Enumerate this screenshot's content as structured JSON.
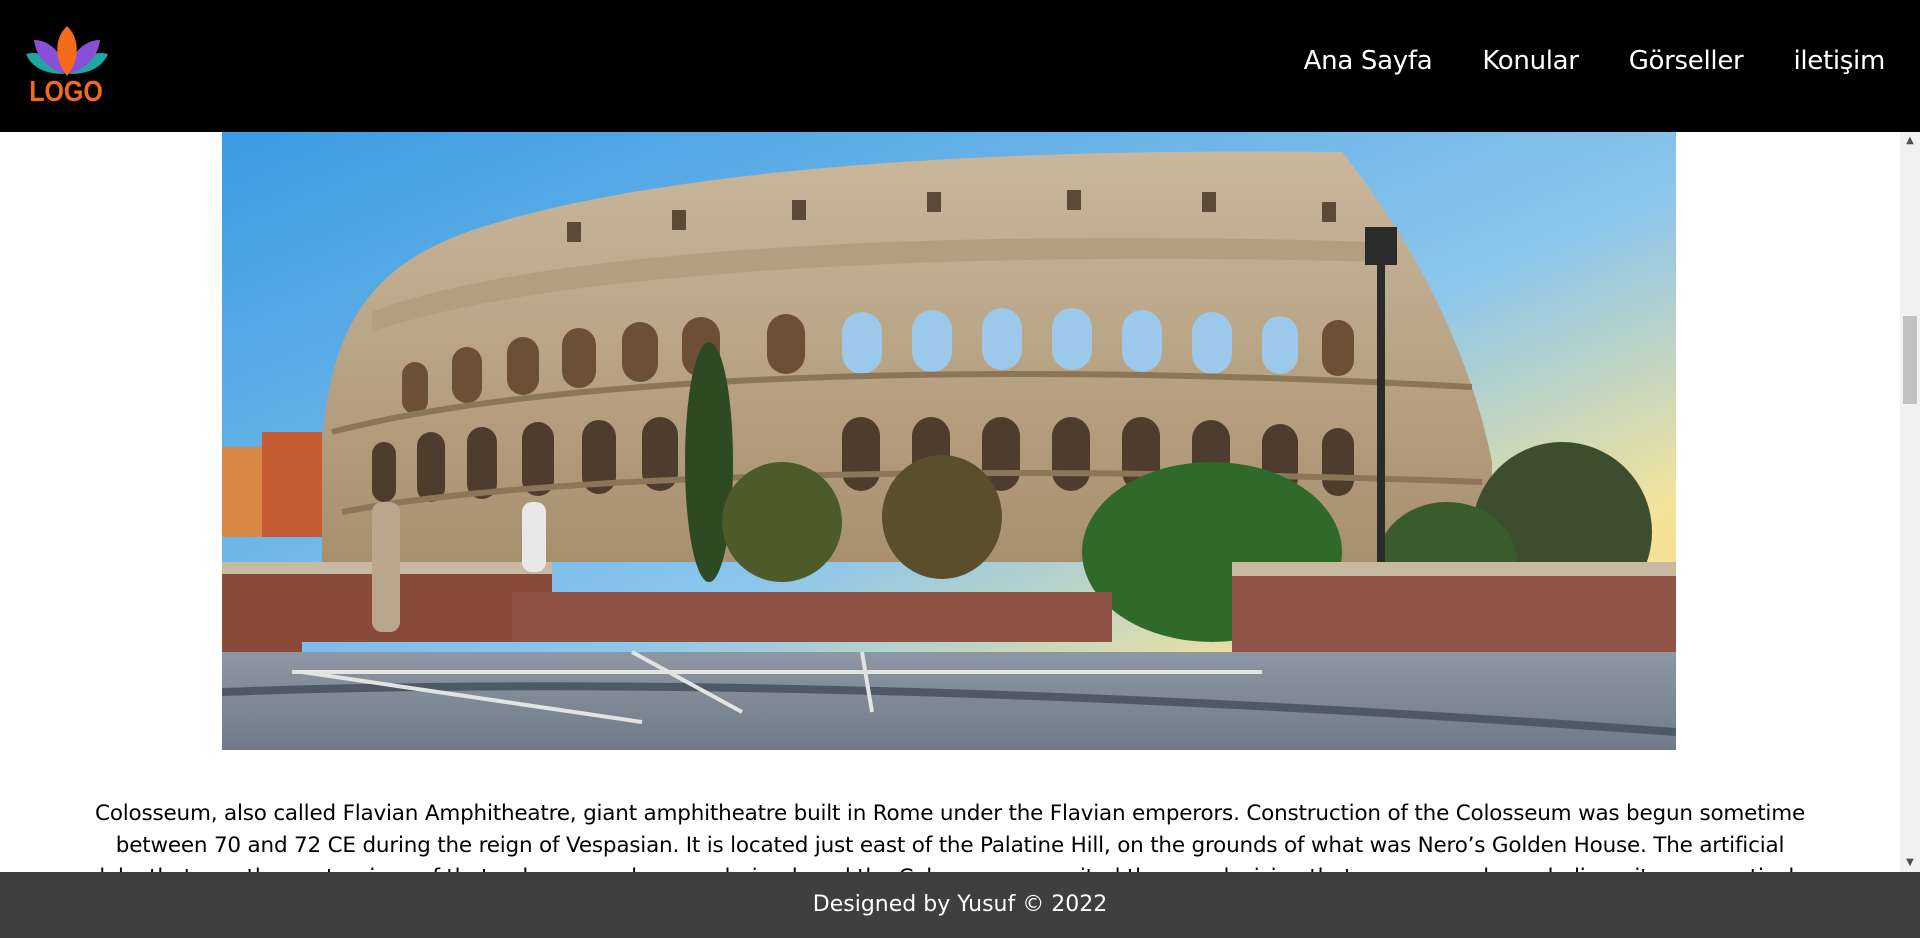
{
  "header": {
    "logo_text": "LOGO",
    "nav": [
      {
        "label": "Ana Sayfa"
      },
      {
        "label": "Konular"
      },
      {
        "label": "Görseller"
      },
      {
        "label": "iletişim"
      }
    ]
  },
  "hero_image": {
    "icon": "colosseum-photo"
  },
  "article": {
    "text": "Colosseum, also called Flavian Amphitheatre, giant amphitheatre built in Rome under the Flavian emperors. Construction of the Colosseum was begun sometime between 70 and 72 CE during the reign of Vespasian. It is located just east of the Palatine Hill, on the grounds of what was Nero’s Golden House. The artificial lake that was the centerpiece of that palace complex was drained, and the Colosseum was sited there, a decision that was as much symbolic as it was practical."
  },
  "footer": {
    "text": "Designed by Yusuf © 2022"
  },
  "colors": {
    "header_bg": "#000000",
    "footer_bg": "#3f3f3f",
    "logo_orange": "#f26a1b"
  }
}
